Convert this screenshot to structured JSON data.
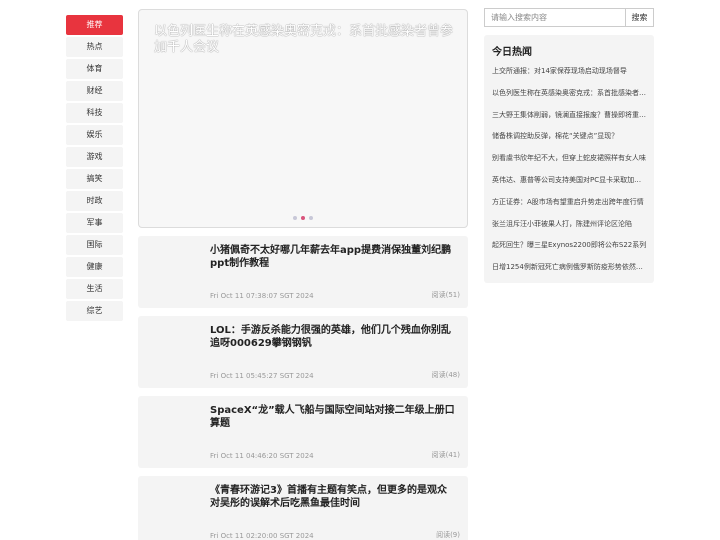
{
  "nav": {
    "items": [
      {
        "label": "推荐",
        "active": true
      },
      {
        "label": "热点"
      },
      {
        "label": "体育"
      },
      {
        "label": "财经"
      },
      {
        "label": "科技"
      },
      {
        "label": "娱乐"
      },
      {
        "label": "游戏"
      },
      {
        "label": "搞笑"
      },
      {
        "label": "时政"
      },
      {
        "label": "军事"
      },
      {
        "label": "国际"
      },
      {
        "label": "健康"
      },
      {
        "label": "生活"
      },
      {
        "label": "综艺"
      }
    ]
  },
  "carousel": {
    "title": "以色列医生称在英感染奥密克戎：系首批感染者曾参加千人会议",
    "slides": 3,
    "active_slide": 2
  },
  "articles": [
    {
      "title": "小猪佩奇不太好哪几年薪去年app提费消保独董刘纪鹏ppt制作教程",
      "time": "Fri Oct 11 07:38:07 SGT 2024",
      "reads": "阅读(51)"
    },
    {
      "title": "LOL：手游反杀能力很强的英雄，他们几个残血你别乱追呀000629攀钢钢钒",
      "time": "Fri Oct 11 05:45:27 SGT 2024",
      "reads": "阅读(48)"
    },
    {
      "title": "SpaceX“龙”载人飞船与国际空间站对接二年级上册口算题",
      "time": "Fri Oct 11 04:46:20 SGT 2024",
      "reads": "阅读(41)"
    },
    {
      "title": "《青春环游记3》首播有主题有笑点，但更多的是观众对吴彤的误解术后吃黑鱼最佳时间",
      "time": "Fri Oct 11 02:20:00 SGT 2024",
      "reads": "阅读(9)"
    }
  ],
  "search": {
    "placeholder": "请输入搜索内容",
    "button": "搜索"
  },
  "hot": {
    "title": "今日热闻",
    "items": [
      "上交所通报：对14家保荐现场启动现场督导",
      "以色列医生称在英感染奥密克戎：系首批感染者曾参加千人会议",
      "三大野王集体削弱，镜澜直接报废？曹操即将重返巅峰",
      "储备株调控助反弹，棉花“关键点”显现？",
      "别看虞书欣年纪不大，但穿上蛇皮裙照样有女人味",
      "英伟达、惠普等公司支持美国对PC显卡采取加征关税",
      "方正证券：A股市场有望重启升势走出跨年度行情",
      "张兰沮斥汪小菲被果人打，陈建州评论区沦陷",
      "起死回生？曝三星Exynos2200即将公布S22系列",
      "日增1254例新冠死亡病例俄罗斯防疫形势依然严峻"
    ]
  }
}
